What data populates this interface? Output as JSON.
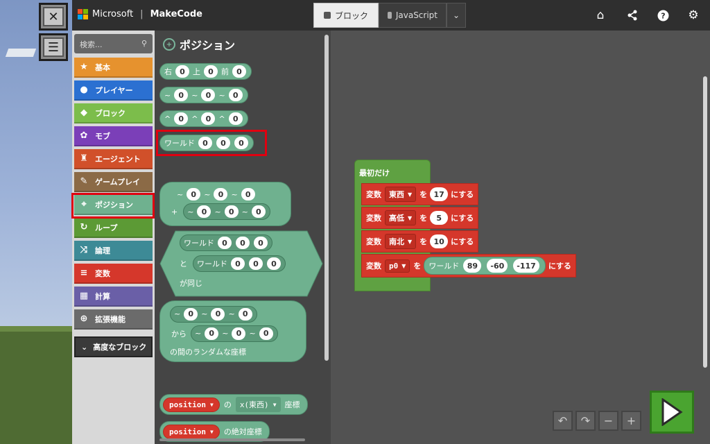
{
  "header": {
    "brand": "Microsoft",
    "app_name": "MakeCode",
    "tabs": [
      {
        "label": "ブロック",
        "active": true
      },
      {
        "label": "JavaScript",
        "active": false
      }
    ],
    "icons": [
      "home-icon",
      "share-icon",
      "help-icon",
      "settings-icon"
    ]
  },
  "minecraft": {
    "buttons": [
      "close-x-icon",
      "menu-icon"
    ]
  },
  "categories": {
    "search_placeholder": "検索...",
    "items": [
      {
        "label": "基本",
        "color": "#e6922e",
        "icon": "star-icon"
      },
      {
        "label": "プレイヤー",
        "color": "#2b70d1",
        "icon": "person-icon"
      },
      {
        "label": "ブロック",
        "color": "#7cbd4b",
        "icon": "cube-icon"
      },
      {
        "label": "モブ",
        "color": "#7b3fb8",
        "icon": "paw-icon"
      },
      {
        "label": "エージェント",
        "color": "#d1502a",
        "icon": "agent-icon"
      },
      {
        "label": "ゲームプレイ",
        "color": "#8b6a46",
        "icon": "wrench-icon"
      },
      {
        "label": "ポジション",
        "color": "#6fb18f",
        "icon": "crosshair-icon"
      },
      {
        "label": "ループ",
        "color": "#5c9a35",
        "icon": "loop-icon"
      },
      {
        "label": "論理",
        "color": "#3d8a96",
        "icon": "shuffle-icon"
      },
      {
        "label": "変数",
        "color": "#d5372b",
        "icon": "list-icon"
      },
      {
        "label": "計算",
        "color": "#6a5fa7",
        "icon": "calculator-icon"
      },
      {
        "label": "拡張機能",
        "color": "#6b6b6b",
        "icon": "plus-icon"
      }
    ],
    "advanced": "高度なブロック"
  },
  "flyout": {
    "title": "ポジション",
    "rel": {
      "right": "右",
      "up": "上",
      "front": "前"
    },
    "tilde": "~",
    "caret": "^",
    "world": "ワールド",
    "plus": "+",
    "and": "と",
    "same": "が同じ",
    "from": "から",
    "random_label": "の間のランダムな座標",
    "zero": "0",
    "position_dd": "position",
    "of": "の",
    "axis_dd": "x(東西)",
    "coord": "座標",
    "absolute": "の絶対座標"
  },
  "workspace": {
    "on_start": "最初だけ",
    "stmts": [
      {
        "var_kw": "変数",
        "name": "東西",
        "to": "を",
        "value": "17",
        "set": "にする"
      },
      {
        "var_kw": "変数",
        "name": "高低",
        "to": "を",
        "value": "5",
        "set": "にする"
      },
      {
        "var_kw": "変数",
        "name": "南北",
        "to": "を",
        "value": "10",
        "set": "にする"
      },
      {
        "var_kw": "変数",
        "name": "p0",
        "to": "を",
        "world": "ワールド",
        "x": "89",
        "y": "-60",
        "z": "-117",
        "set": "にする"
      }
    ]
  }
}
